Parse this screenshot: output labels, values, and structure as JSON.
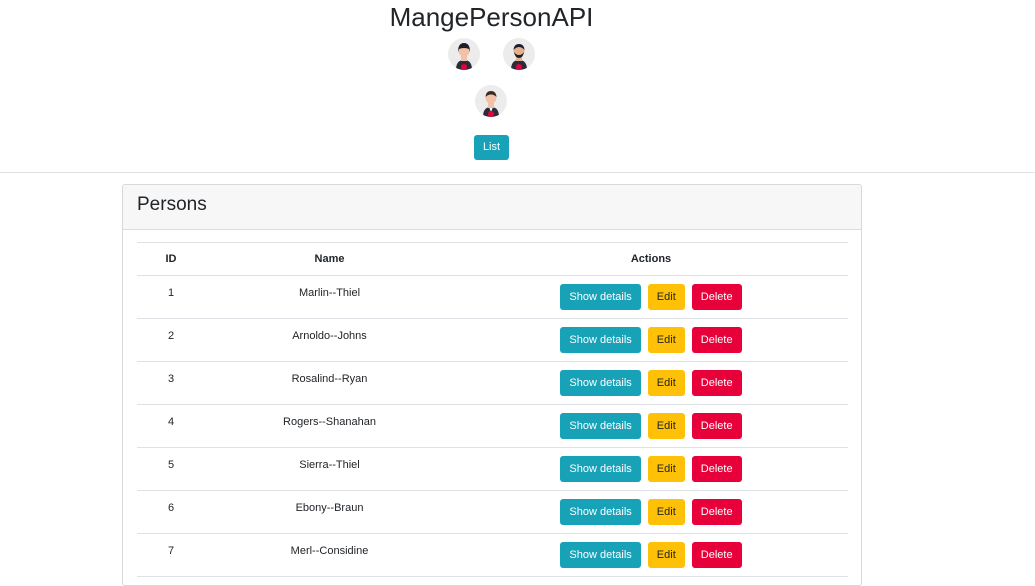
{
  "app": {
    "title": "MangePersonAPI",
    "list_button": "List"
  },
  "avatars": [
    {
      "icon": "woman-avatar-icon"
    },
    {
      "icon": "man-beard-avatar-icon"
    },
    {
      "icon": "man-avatar-icon"
    }
  ],
  "card": {
    "title": "Persons"
  },
  "table": {
    "headers": {
      "id": "ID",
      "name": "Name",
      "actions": "Actions"
    },
    "action_labels": {
      "details": "Show details",
      "edit": "Edit",
      "delete": "Delete"
    },
    "rows": [
      {
        "id": "1",
        "name": "Marlin--Thiel"
      },
      {
        "id": "2",
        "name": "Arnoldo--Johns"
      },
      {
        "id": "3",
        "name": "Rosalind--Ryan"
      },
      {
        "id": "4",
        "name": "Rogers--Shanahan"
      },
      {
        "id": "5",
        "name": "Sierra--Thiel"
      },
      {
        "id": "6",
        "name": "Ebony--Braun"
      },
      {
        "id": "7",
        "name": "Merl--Considine"
      }
    ]
  },
  "colors": {
    "info": "#17a2b8",
    "warning": "#ffc107",
    "danger": "#e8003a"
  }
}
